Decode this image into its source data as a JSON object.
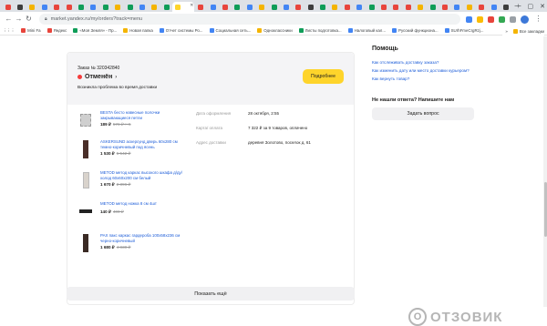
{
  "browser": {
    "tab_colors": [
      "#e8453c",
      "#3d3d3d",
      "#f4b400",
      "#4285f4",
      "#e8453c",
      "#e8453c",
      "#0f9d58",
      "#4285f4",
      "#0f9d58",
      "#f4b400",
      "#0f9d58",
      "#4285f4",
      "#f4b400",
      "#0f9d58",
      "#e8453c",
      "#4285f4",
      "#e8453c",
      "#0f9d58",
      "#4285f4",
      "#f4b400",
      "#0f9d58",
      "#4285f4",
      "#e8453c",
      "#3d3d3d",
      "#0f9d58",
      "#f4b400",
      "#e8453c",
      "#4285f4",
      "#0f9d58",
      "#e8453c",
      "#e8453c",
      "#e8453c",
      "#f4b400",
      "#0f9d58",
      "#e8453c",
      "#4285f4",
      "#f4b400",
      "#e8453c",
      "#4285f4",
      "#3d3d3d"
    ],
    "active_tab_color": "#fed42b",
    "new_tab_label": "+",
    "window_controls": [
      "⌄",
      "—",
      "▢",
      "✕"
    ],
    "url": "market.yandex.ru/my/orders?track=menu",
    "bookmarks": [
      {
        "label": "Mini Fa",
        "color": "#e8453c"
      },
      {
        "label": "Яндекс",
        "color": "#e8453c"
      },
      {
        "label": "«Моя Земля» - Пр...",
        "color": "#0f9d58"
      },
      {
        "label": "Новая папка",
        "color": "#f4b400"
      },
      {
        "label": "Отчет системы Ро...",
        "color": "#4285f4"
      },
      {
        "label": "Социальная сеть...",
        "color": "#4285f4"
      },
      {
        "label": "Одноклассники",
        "color": "#f4b400"
      },
      {
        "label": "Листы подготовка...",
        "color": "#0f9d58"
      },
      {
        "label": "Налоговый кал...",
        "color": "#4285f4"
      },
      {
        "label": "Русский функциона...",
        "color": "#4285f4"
      },
      {
        "label": "SUrhFmeCrgRzj...",
        "color": "#4285f4"
      }
    ],
    "bookmarks_more": "»",
    "bookmarks_all": "Все закладки"
  },
  "order": {
    "number": "Заказ № 320342840",
    "status": "Отменён",
    "delay_note": "Возникла проблема во время доставки",
    "details_button": "Подробнее",
    "items": [
      {
        "title": "BESTA бесто навесные полочки закрывающиеся петли",
        "price": "189 ₽",
        "old_price": "576 ₽ × 5",
        "thumb_color": "#cfcfcf"
      },
      {
        "title": "ASKERSUND аскерсунд дверь 60х280 см темно-коричневый под ясень",
        "price": "1 530 ₽",
        "old_price": "5 542 ₽",
        "thumb_color": "#4a2e28"
      },
      {
        "title": "METOD метод каркас высокого шкафа д/ду/холод 60х60х200 см белый",
        "price": "1 670 ₽",
        "old_price": "2 396 ₽",
        "thumb_color": "#d9d3cc"
      },
      {
        "title": "METOD метод ножка 8 см 4шт",
        "price": "140 ₽",
        "old_price": "400 ₽",
        "thumb_color": "#222222"
      },
      {
        "title": "PAX пакс каркас гардероба 100х58х236 см черно-коричневый",
        "price": "1 680 ₽",
        "old_price": "4 830 ₽",
        "thumb_color": "#3a2a24"
      }
    ],
    "meta": [
      {
        "label": "Дата оформления",
        "value": "28 октября, 2:55"
      },
      {
        "label": "Карта/ оплата",
        "value": "7 322 ₽ за 9 товаров, оплачено"
      },
      {
        "label": "Адрес доставки",
        "value": "деревня Золотово, поселок д. 61"
      }
    ],
    "show_more": "Показать ещё"
  },
  "help": {
    "title": "Помощь",
    "links": [
      "Как отслеживать доставку заказа?",
      "Как изменить дату или место доставки курьером?",
      "Как вернуть товар?"
    ],
    "question": "Не нашли ответа? Напишите нам",
    "ask_button": "Задать вопрос"
  },
  "watermark": {
    "text": "ОТЗОВИК",
    "logo": "О"
  }
}
